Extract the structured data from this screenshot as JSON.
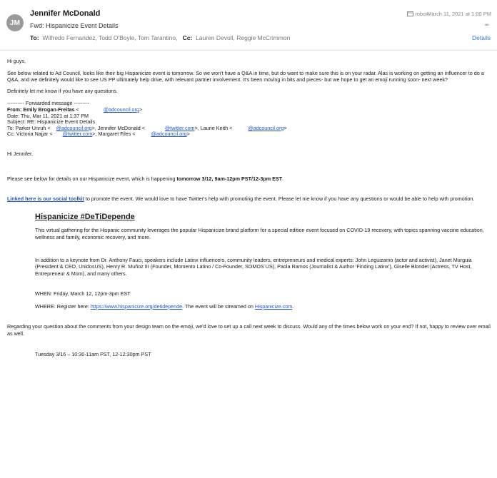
{
  "header": {
    "avatar": "JM",
    "sender": "Jennifer McDonald",
    "subject": "Fwd: Hispanicize Event Details",
    "to_label": "To:",
    "to": "Wilfredo Fernandez,   Todd O'Boyle,   Tom Tarantino,",
    "cc_label": "Cc:",
    "cc": "Lauren Devoll,   Reggie McCrimmon",
    "mailbox": "mbox",
    "date": "March 11, 2021 at 1:00 PM",
    "details": "Details"
  },
  "body": {
    "greeting": "Hi guys,",
    "p1": "See below related to Ad Council, looks like their big Hispanicize event is tomorrow. So we won't have a Q&A in time, but do want to make sure this is on your radar. Alas is working on getting an influencer to do a Q&A, and we definitely would like to see US PP ultimately help drive, with relevant partner involvement. It's been moving in bits and pieces- but we hope to get an emoji running soon- next week?",
    "p2": "Definitely let me know if you have any questions.",
    "fwd": {
      "line": "---------- Forwarded message ---------",
      "from_label": "From:",
      "from_name": "Emily Brogan-Freitas",
      "from_a": "<",
      "from_email": "@adcouncil.org",
      "from_b": ">",
      "date": "Date: Thu, Mar 11, 2021 at 1:37 PM",
      "subject": "Subject: RE: Hispanicize Event Details",
      "to_a": "To: Parker Unruh <",
      "to_e1": "@adcouncil.org",
      "to_b": ">, Jennifer McDonald <",
      "to_e2": "@twitter.com",
      "to_c": ">, Laurie Keith <",
      "to_e3": "@adcouncil.org",
      "to_d": ">",
      "cc_a": "Cc: Victoria Najjar <",
      "cc_e1": "@twitter.com",
      "cc_b": ">, Margaret Files <",
      "cc_e2": "@adcouncil.org",
      "cc_c": ">"
    },
    "hi": "Hi Jennifer,",
    "p3_a": "Please see below for details on our Hispanicize event, which is happening ",
    "p3_b": "tomorrow 3/12, 9am-12pm PST/12-3pm EST",
    "p3_c": ".",
    "p4_link": "Linked here is our social toolkit",
    "p4_rest": " to promote the event. We would love to have Twitter's help with promoting the event. Please let me know if you have any questions or would be able to help with promotion.",
    "event": {
      "title": "Hispanicize #DeTiDepende",
      "d1": "This virtual gathering for the Hispanic community leverages the popular Hispanicize brand platform for a special edition event focused on COVID-19 recovery, with topics spanning vaccine education, wellness and family, economic recovery, and more.",
      "d2": "In addition to a keynote from Dr. Anthony Fauci, speakers include Latinx influencers, community leaders, entrepreneurs and medical experts: John Leguizamo (actor and activist), Janet Murguia (President & CEO, UnidosUS), Henry R. Muñoz III (Founder, Momento Latino / Co-Founder, SOMOS US), Paola Ramos (Journalist & Author 'Finding Latinx'), Giselle Blondet (Actress, TV Host, Entrepreneur & Mom), and many others.",
      "when": "WHEN: Friday, March 12, 12pm-3pm EST",
      "where_a": "WHERE: Register here: ",
      "where_link": "https://www.hispanicize.org/detidepende",
      "where_b": ". The event will be streamed on ",
      "where_link2": "Hispanicize.com",
      "where_c": "."
    },
    "p5": "Regarding your question about the comments from your design team on the emoji, we'd love to set up a call next week to discuss. Would any of the times below work on your end? If not, happy to review over email as well.",
    "time1": "Tuesday 3/16 – 10:30-11am PST, 12-12:30pm PST"
  }
}
